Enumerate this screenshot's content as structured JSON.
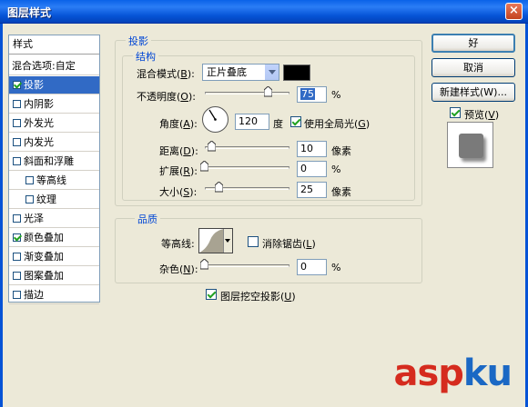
{
  "window": {
    "title": "图层样式",
    "close_glyph": "×"
  },
  "styles_list": {
    "header": "样式",
    "blend_options": "混合选项:自定",
    "items": [
      {
        "label": "投影",
        "checked": true,
        "selected": true,
        "indent": false
      },
      {
        "label": "内阴影",
        "checked": false,
        "selected": false,
        "indent": false
      },
      {
        "label": "外发光",
        "checked": false,
        "selected": false,
        "indent": false
      },
      {
        "label": "内发光",
        "checked": false,
        "selected": false,
        "indent": false
      },
      {
        "label": "斜面和浮雕",
        "checked": false,
        "selected": false,
        "indent": false
      },
      {
        "label": "等高线",
        "checked": false,
        "selected": false,
        "indent": true
      },
      {
        "label": "纹理",
        "checked": false,
        "selected": false,
        "indent": true
      },
      {
        "label": "光泽",
        "checked": false,
        "selected": false,
        "indent": false
      },
      {
        "label": "颜色叠加",
        "checked": true,
        "selected": false,
        "indent": false
      },
      {
        "label": "渐变叠加",
        "checked": false,
        "selected": false,
        "indent": false
      },
      {
        "label": "图案叠加",
        "checked": false,
        "selected": false,
        "indent": false
      },
      {
        "label": "描边",
        "checked": false,
        "selected": false,
        "indent": false
      }
    ]
  },
  "drop_shadow": {
    "group_title": "投影",
    "structure_title": "结构",
    "blend_mode": {
      "label": "混合模式",
      "key": "B",
      "value": "正片叠底",
      "color": "#000000"
    },
    "opacity": {
      "label": "不透明度",
      "key": "O",
      "value": "75",
      "unit": "%",
      "level": 0.75
    },
    "angle": {
      "label": "角度",
      "key": "A",
      "value": "120",
      "unit": "度",
      "global_light": {
        "label": "使用全局光",
        "key": "G",
        "checked": true
      }
    },
    "distance": {
      "label": "距离",
      "key": "D",
      "value": "10",
      "unit": "像素"
    },
    "spread": {
      "label": "扩展",
      "key": "R",
      "value": "0",
      "unit": "%"
    },
    "size": {
      "label": "大小",
      "key": "S",
      "value": "25",
      "unit": "像素"
    },
    "quality_title": "品质",
    "contour": {
      "label": "等高线:",
      "anti_alias": {
        "label": "消除锯齿",
        "key": "L",
        "checked": false
      }
    },
    "noise": {
      "label": "杂色",
      "key": "N",
      "value": "0",
      "unit": "%"
    },
    "knockout": {
      "label": "图层挖空投影",
      "key": "U",
      "checked": true
    }
  },
  "buttons": {
    "ok": "好",
    "cancel": "取消",
    "new_style": "新建样式(W)...",
    "preview": {
      "label": "预览",
      "key": "V",
      "checked": true
    }
  },
  "watermark": {
    "text_a": "asp",
    "text_b": "ku"
  }
}
